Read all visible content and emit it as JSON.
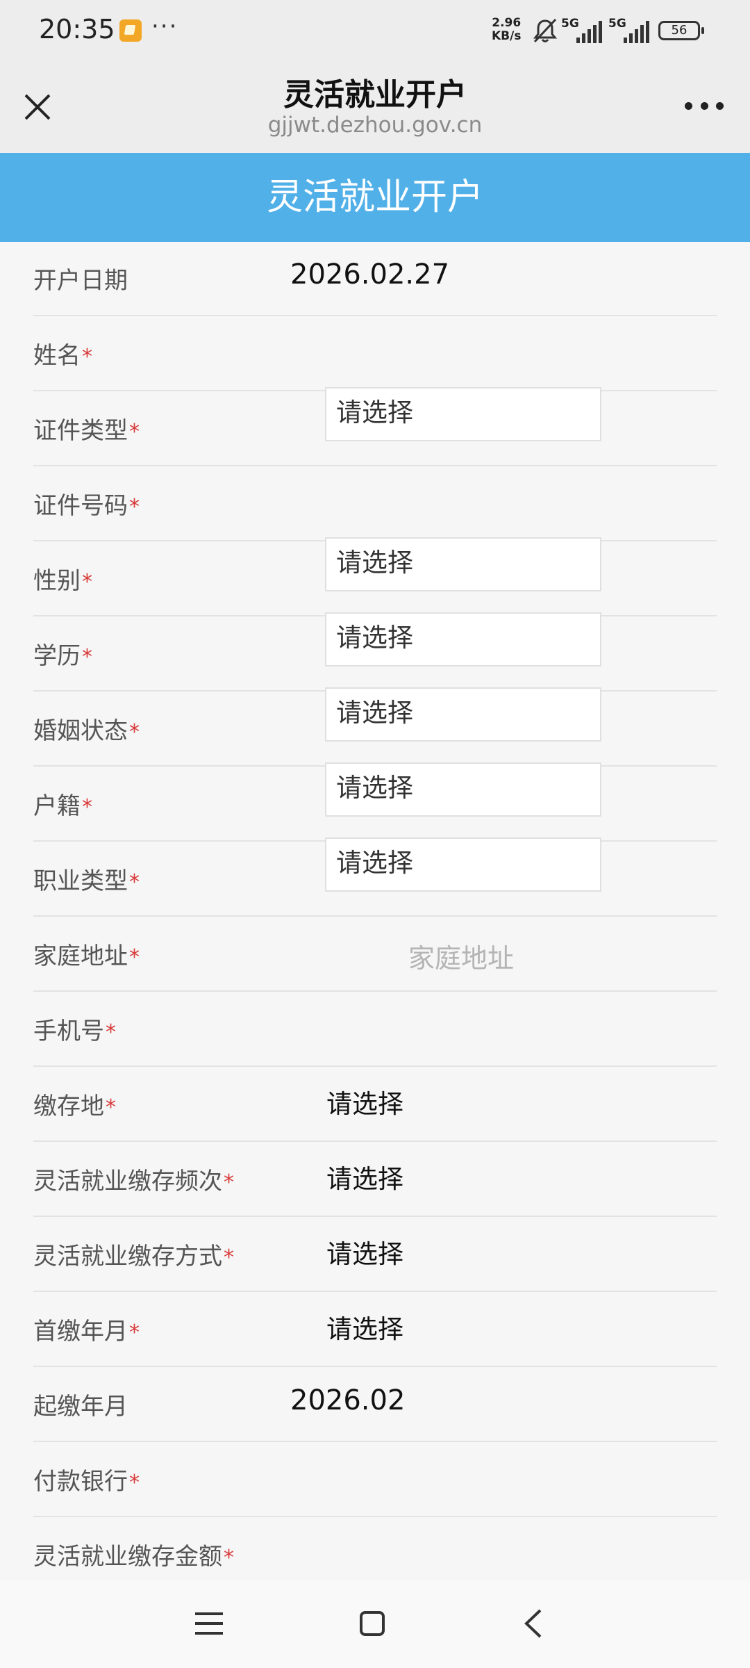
{
  "status_bar": {
    "time": "20:35",
    "net_speed_value": "2.96",
    "net_speed_unit": "KB/s",
    "signal1_label": "5G",
    "signal2_label": "5G",
    "battery": "56"
  },
  "browser": {
    "title": "灵活就业开户",
    "url": "gjjwt.dezhou.gov.cn"
  },
  "page": {
    "banner_title": "灵活就业开户"
  },
  "form": {
    "required_mark": "*",
    "fields": [
      {
        "label": "开户日期",
        "value": "2026.02.27"
      },
      {
        "label": "姓名"
      },
      {
        "label": "证件类型",
        "value": "请选择"
      },
      {
        "label": "证件号码"
      },
      {
        "label": "性别",
        "value": "请选择"
      },
      {
        "label": "学历",
        "value": "请选择"
      },
      {
        "label": "婚姻状态",
        "value": "请选择"
      },
      {
        "label": "户籍",
        "value": "请选择"
      },
      {
        "label": "职业类型",
        "value": "请选择"
      },
      {
        "label": "家庭地址",
        "placeholder": "家庭地址"
      },
      {
        "label": "手机号"
      },
      {
        "label": "缴存地",
        "value": "请选择"
      },
      {
        "label": "灵活就业缴存频次",
        "value": "请选择"
      },
      {
        "label": "灵活就业缴存方式",
        "value": "请选择"
      },
      {
        "label": "首缴年月",
        "value": "请选择"
      },
      {
        "label": "起缴年月",
        "value": "2026.02"
      },
      {
        "label": "付款银行"
      },
      {
        "label": "灵活就业缴存金额"
      }
    ]
  }
}
